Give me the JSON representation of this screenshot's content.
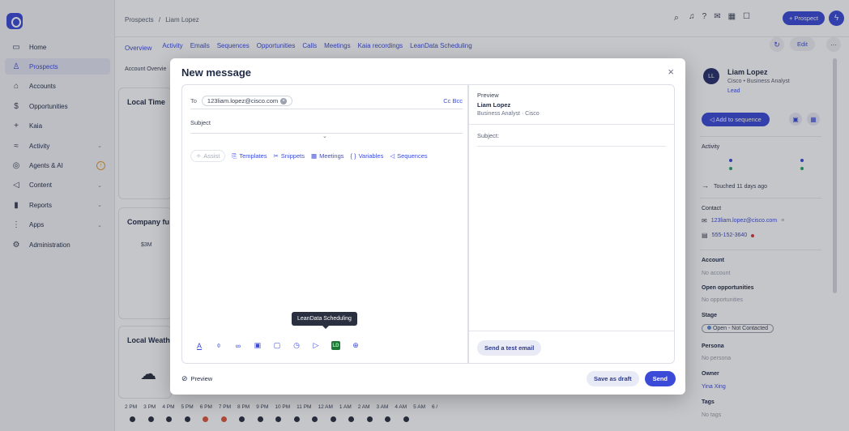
{
  "sidebar": {
    "items": [
      {
        "label": "Home",
        "icon": "home-icon",
        "glyph": "▭",
        "chevron": false
      },
      {
        "label": "Prospects",
        "icon": "person-icon",
        "glyph": "♙",
        "chevron": false,
        "active": true
      },
      {
        "label": "Accounts",
        "icon": "building-icon",
        "glyph": "⌂",
        "chevron": false
      },
      {
        "label": "Opportunities",
        "icon": "dollar-icon",
        "glyph": "$",
        "chevron": false
      },
      {
        "label": "Kaia",
        "icon": "kaia-icon",
        "glyph": "+",
        "chevron": false
      },
      {
        "label": "Activity",
        "icon": "activity-icon",
        "glyph": "≈",
        "chevron": true
      },
      {
        "label": "Agents & AI",
        "icon": "agents-icon",
        "glyph": "◎",
        "chevron": false,
        "badge": "↑"
      },
      {
        "label": "Content",
        "icon": "send-icon",
        "glyph": "◁",
        "chevron": true
      },
      {
        "label": "Reports",
        "icon": "bars-icon",
        "glyph": "▮",
        "chevron": true
      },
      {
        "label": "Apps",
        "icon": "grid-icon",
        "glyph": "⋮",
        "chevron": true
      },
      {
        "label": "Administration",
        "icon": "gear-icon",
        "glyph": "⚙",
        "chevron": false
      }
    ]
  },
  "topbar": {
    "breadcrumb": [
      "Prospects",
      "/",
      "Liam Lopez"
    ],
    "prospect_button": "+ Prospect"
  },
  "record_tabs": [
    "Overview",
    "Activity",
    "Emails",
    "Sequences",
    "Opportunities",
    "Calls",
    "Meetings",
    "Kaia recordings",
    "LeanData Scheduling"
  ],
  "record_actions": {
    "edit": "Edit",
    "more": "···"
  },
  "background": {
    "account_overview": "Account Overvie",
    "local_time": "Local Time",
    "company_funding": "Company fu",
    "funding_value": "$3M",
    "local_weather": "Local Weath",
    "hours": [
      "2 PM",
      "3 PM",
      "4 PM",
      "5 PM",
      "6 PM",
      "7 PM",
      "8 PM",
      "9 PM",
      "10 PM",
      "11 PM",
      "12 AM",
      "1 AM",
      "2 AM",
      "3 AM",
      "4 AM",
      "5 AM",
      "6 /"
    ]
  },
  "modal": {
    "title": "New message",
    "close": "×",
    "to_label": "To",
    "recipient": "123liam.lopez@cisco.com",
    "cc_bcc": "Cc Bcc",
    "subject_placeholder": "Subject",
    "toolbar": {
      "assist": "Assist",
      "templates": "Templates",
      "snippets": "Snippets",
      "meetings": "Meetings",
      "variables": "Variables",
      "sequences": "Sequences"
    },
    "format_icons": [
      "text-color-icon",
      "attach-icon",
      "link-icon",
      "image-icon",
      "document-icon",
      "clock-icon",
      "pointer-icon",
      "leandata-icon",
      "more-icon"
    ],
    "tooltip": "LeanData Scheduling",
    "leandata_mark": "LD",
    "preview": {
      "label": "Preview",
      "name": "Liam Lopez",
      "subtitle": "Business Analyst  ·  Cisco",
      "subject_label": "Subject:",
      "test_button": "Send a test email"
    },
    "footer": {
      "preview_toggle": "Preview",
      "save_draft": "Save as draft",
      "send": "Send"
    }
  },
  "right_panel": {
    "avatar": "LL",
    "name": "Liam Lopez",
    "role": "Cisco • Business Analyst",
    "status": "Lead",
    "add_to_sequence": "Add to sequence",
    "activity_label": "Activity",
    "touched": "Touched 11 days ago",
    "contact_label": "Contact",
    "email": "123liam.lopez@cisco.com",
    "phone": "555-152-3640",
    "account_label": "Account",
    "account_value": "No account",
    "opps_label": "Open opportunities",
    "opps_value": "No opportunities",
    "stage_label": "Stage",
    "stage_value": "Open - Not Contacted",
    "persona_label": "Persona",
    "persona_value": "No persona",
    "owner_label": "Owner",
    "owner_value": "Yina Xing",
    "tags_label": "Tags",
    "tags_value": "No tags"
  },
  "colors": {
    "accent": "#3b4bd8",
    "tooltip": "#2b3040",
    "leandata": "#1f7a3a"
  }
}
